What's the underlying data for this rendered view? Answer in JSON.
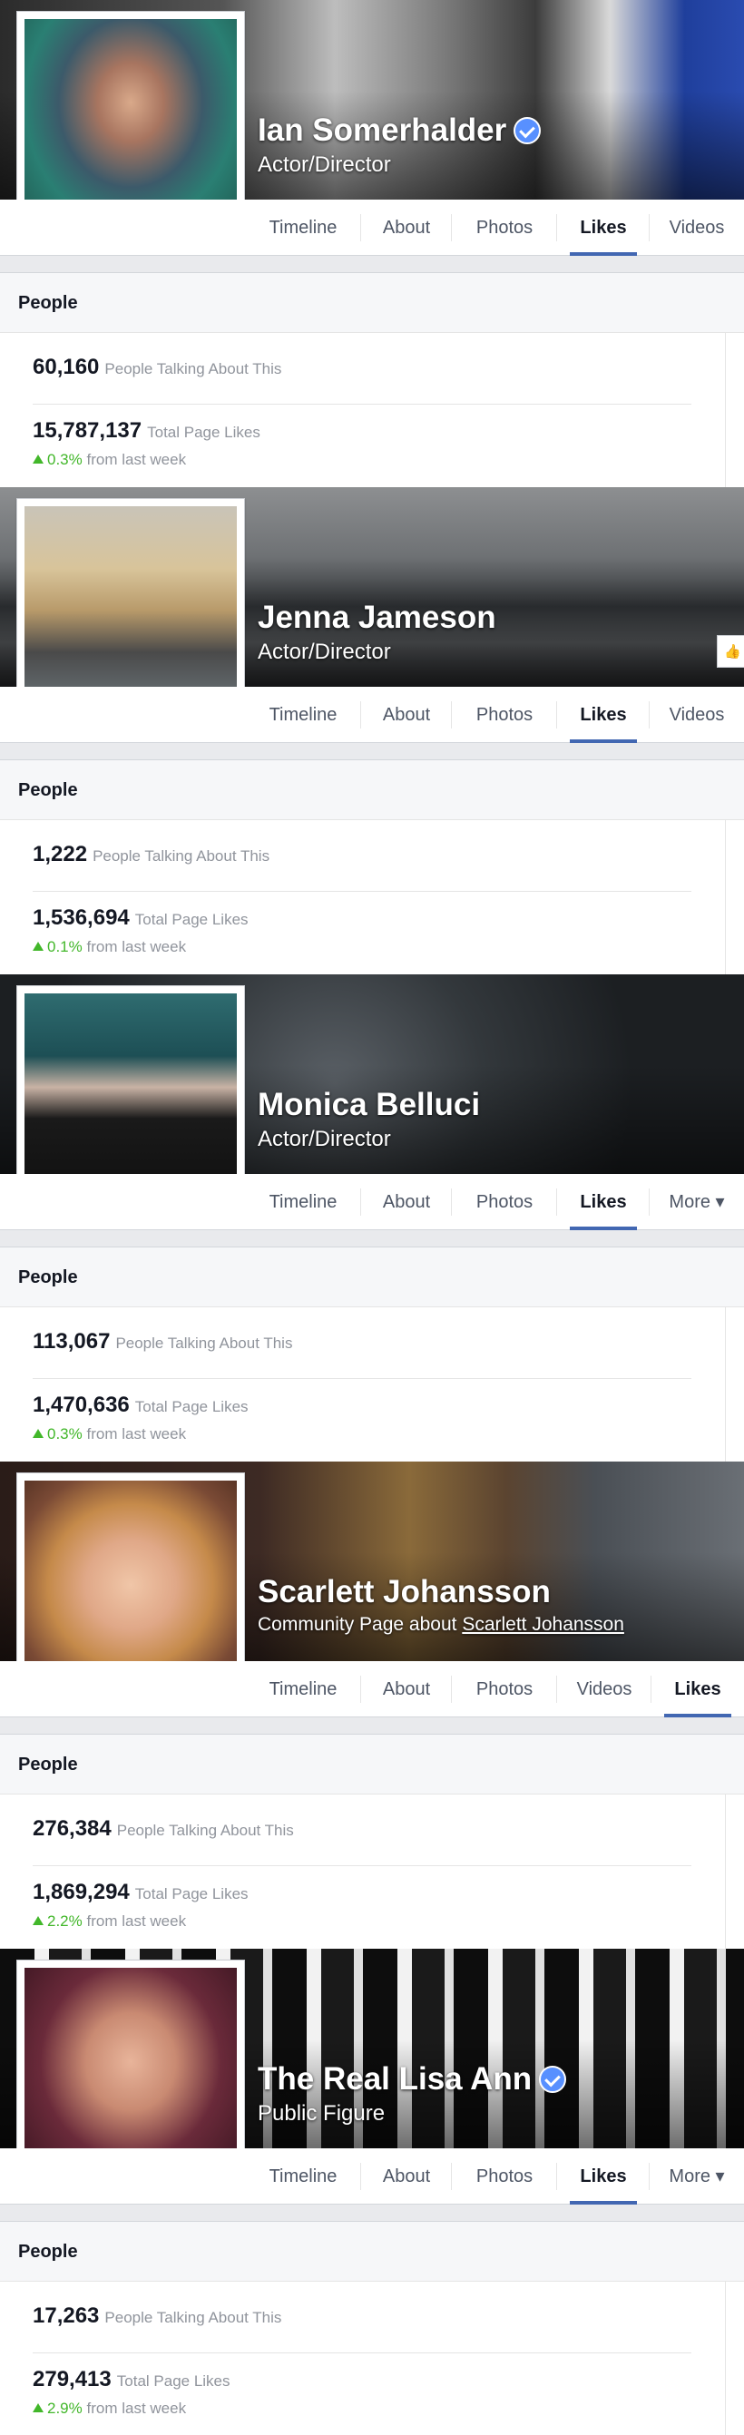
{
  "profiles": [
    {
      "name": "Ian Somerhalder",
      "verified": true,
      "category": "Actor/Director",
      "tabs": [
        "Timeline",
        "About",
        "Photos",
        "Likes",
        "Videos"
      ],
      "active_tab": "Likes",
      "people_header": "People",
      "talking_value": "60,160",
      "talking_label": "People Talking About This",
      "likes_value": "15,787,137",
      "likes_label": "Total Page Likes",
      "change_pct": "0.3%",
      "change_label": "from last week"
    },
    {
      "name": "Jenna Jameson",
      "verified": false,
      "category": "Actor/Director",
      "tabs": [
        "Timeline",
        "About",
        "Photos",
        "Likes",
        "Videos"
      ],
      "active_tab": "Likes",
      "people_header": "People",
      "talking_value": "1,222",
      "talking_label": "People Talking About This",
      "likes_value": "1,536,694",
      "likes_label": "Total Page Likes",
      "change_pct": "0.1%",
      "change_label": "from last week"
    },
    {
      "name": "Monica Belluci",
      "verified": false,
      "category": "Actor/Director",
      "tabs": [
        "Timeline",
        "About",
        "Photos",
        "Likes",
        "More ▾"
      ],
      "active_tab": "Likes",
      "people_header": "People",
      "talking_value": "113,067",
      "talking_label": "People Talking About This",
      "likes_value": "1,470,636",
      "likes_label": "Total Page Likes",
      "change_pct": "0.3%",
      "change_label": "from last week"
    },
    {
      "name": "Scarlett Johansson",
      "verified": false,
      "category_prefix": "Community Page about",
      "category_link": "Scarlett Johansson",
      "tabs": [
        "Timeline",
        "About",
        "Photos",
        "Videos",
        "Likes"
      ],
      "active_tab": "Likes",
      "people_header": "People",
      "talking_value": "276,384",
      "talking_label": "People Talking About This",
      "likes_value": "1,869,294",
      "likes_label": "Total Page Likes",
      "change_pct": "2.2%",
      "change_label": "from last week"
    },
    {
      "name": "The Real Lisa Ann",
      "verified": true,
      "category": "Public Figure",
      "tabs": [
        "Timeline",
        "About",
        "Photos",
        "Likes",
        "More ▾"
      ],
      "active_tab": "Likes",
      "people_header": "People",
      "talking_value": "17,263",
      "talking_label": "People Talking About This",
      "likes_value": "279,413",
      "likes_label": "Total Page Likes",
      "change_pct": "2.9%",
      "change_label": "from last week"
    }
  ],
  "colors": {
    "accent": "#4267b2",
    "positive": "#42b72a",
    "verified": "#5890ff"
  }
}
